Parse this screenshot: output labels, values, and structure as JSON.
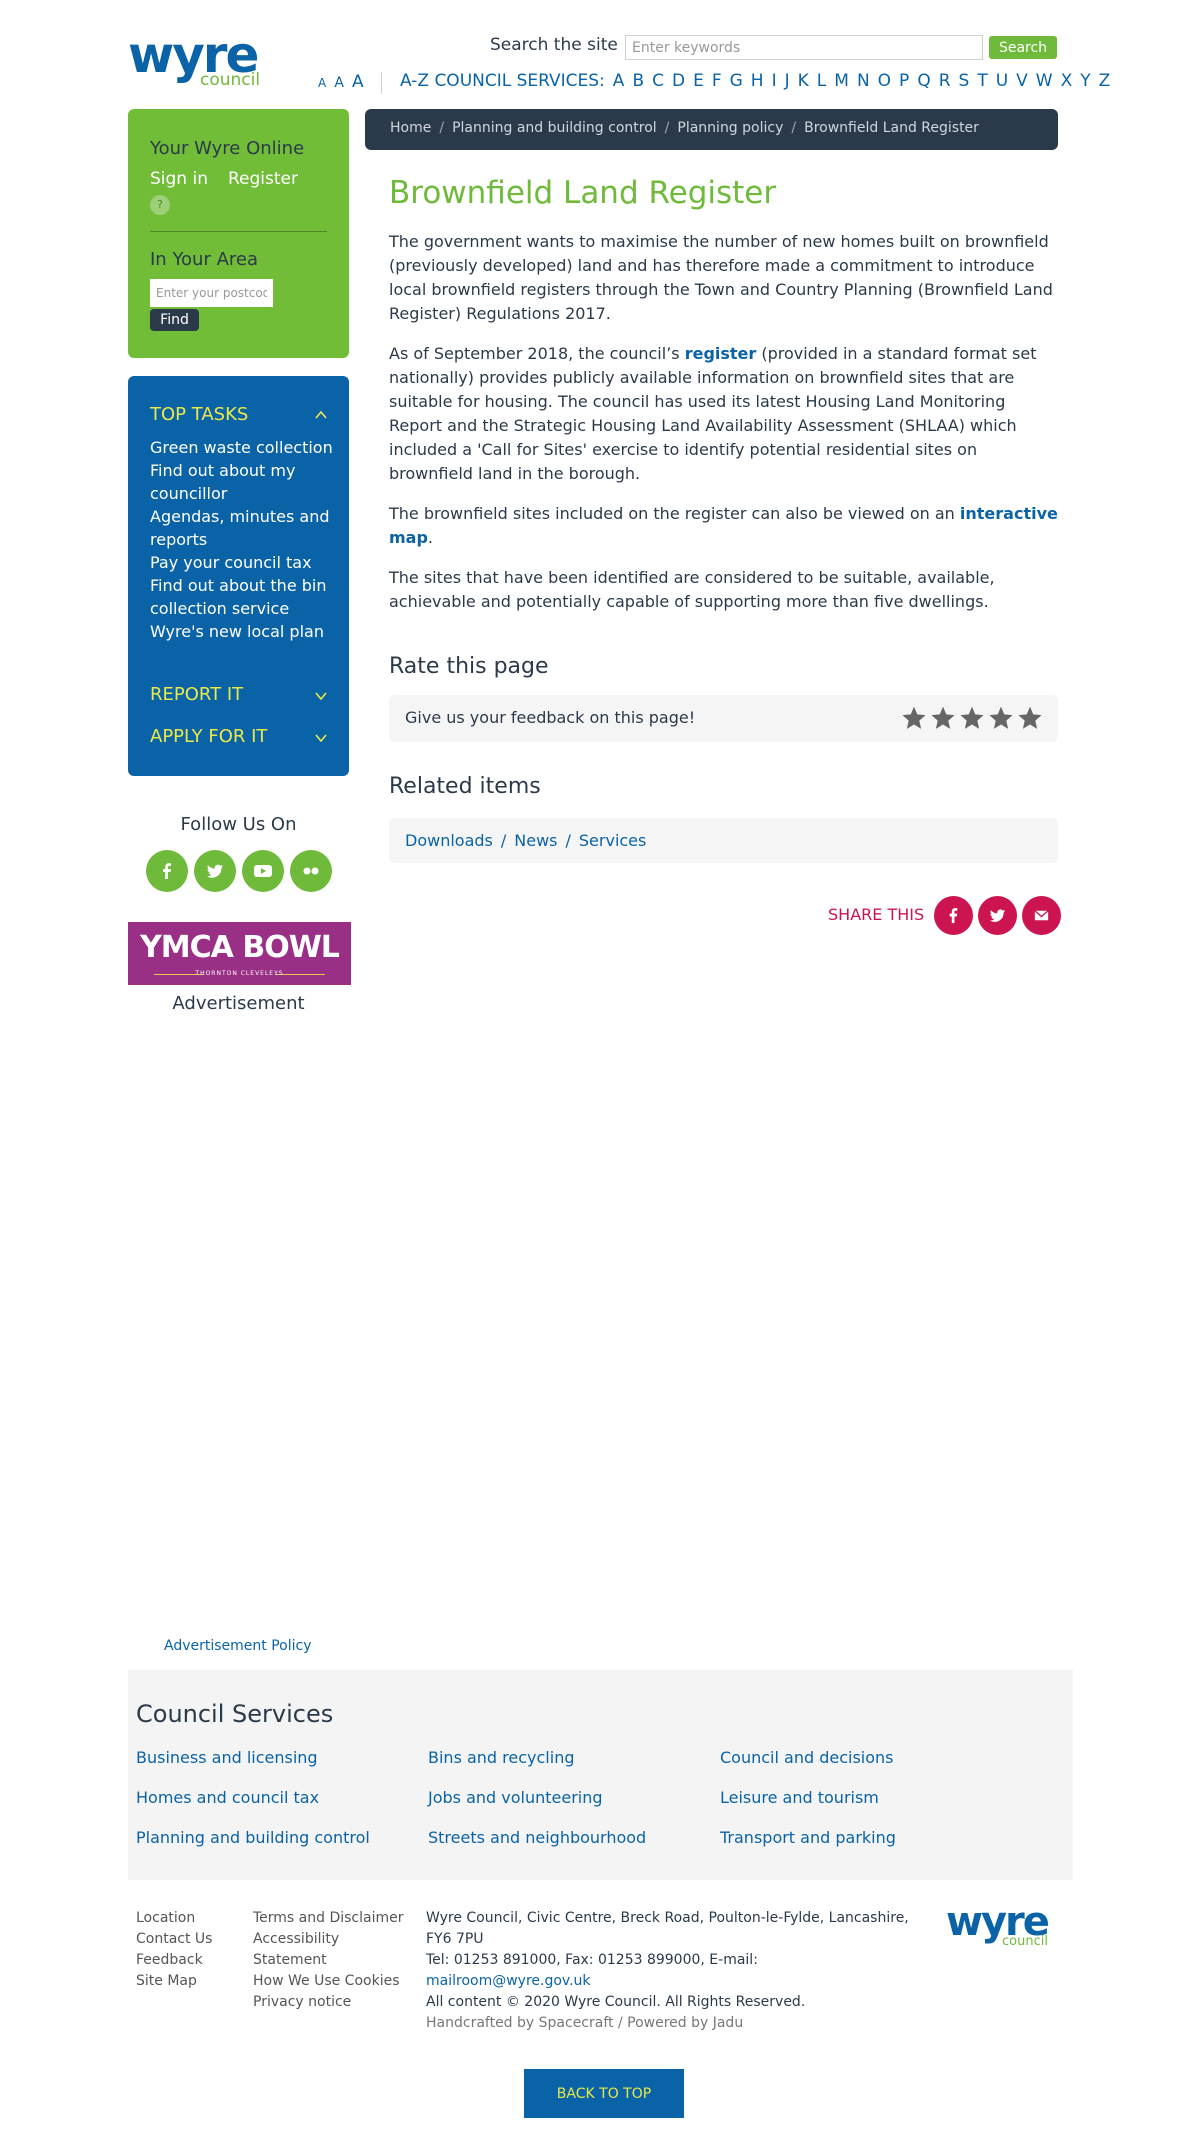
{
  "header": {
    "logo_word": "wyre",
    "logo_sub": "council",
    "search_label": "Search the site",
    "search_placeholder": "Enter keywords",
    "search_button": "Search",
    "text_size": [
      "A",
      "A",
      "A"
    ],
    "az_label": "A-Z COUNCIL SERVICES:",
    "az_letters": [
      "A",
      "B",
      "C",
      "D",
      "E",
      "F",
      "G",
      "H",
      "I",
      "J",
      "K",
      "L",
      "M",
      "N",
      "O",
      "P",
      "Q",
      "R",
      "S",
      "T",
      "U",
      "V",
      "W",
      "X",
      "Y",
      "Z"
    ]
  },
  "sidebar": {
    "online_title": "Your Wyre Online",
    "sign_in": "Sign in",
    "register": "Register",
    "help": "?",
    "area_title": "In Your Area",
    "postcode_placeholder": "Enter your postcode",
    "find_button": "Find",
    "top_tasks": "TOP TASKS",
    "tasks": [
      "Green waste collection",
      "Find out about my councillor",
      "Agendas, minutes and reports",
      "Pay your council tax",
      "Find out about the bin collection service",
      "Wyre's new local plan"
    ],
    "report_it": "REPORT IT",
    "apply_for_it": "APPLY FOR IT",
    "follow_title": "Follow Us On",
    "social_icons": [
      "facebook-icon",
      "twitter-icon",
      "youtube-icon",
      "flickr-icon"
    ],
    "ad_text": "YMCA BOWL",
    "ad_sub": "THORNTON CLEVELEYS",
    "ad_caption": "Advertisement",
    "ad_policy": "Advertisement Policy"
  },
  "breadcrumb": [
    "Home",
    "Planning and building control",
    "Planning policy",
    "Brownfield Land Register"
  ],
  "main": {
    "title": "Brownfield Land Register",
    "p1": "The government wants to maximise the number of new homes built on brownfield (previously developed) land and has therefore made a commitment to introduce local brownfield registers through the Town and Country Planning (Brownfield Land Register) Regulations 2017.",
    "p2_before": "As of September 2018, the council’s ",
    "p2_link": "register",
    "p2_after": " (provided in a standard format set nationally) provides publicly available information on brownfield sites that are suitable for housing. The council has used its latest Housing Land Monitoring Report and the Strategic Housing Land Availability Assessment (SHLAA) which included a 'Call for Sites' exercise to identify potential residential sites on brownfield land in the borough.",
    "p3_before": "The brownfield sites included on the register can also be viewed on an ",
    "p3_link": "interactive map",
    "p3_after": ".",
    "p4": "The sites that have been identified are considered to be suitable, available, achievable and potentially capable of supporting more than five dwellings.",
    "rate_title": "Rate this page",
    "rate_text": "Give us your feedback on this page!",
    "related_title": "Related items",
    "related": [
      "Downloads",
      "News",
      "Services"
    ],
    "share_label": "SHARE THIS"
  },
  "footer": {
    "services_title": "Council Services",
    "services": [
      "Business and licensing",
      "Bins and recycling",
      "Council and decisions",
      "Homes and council tax",
      "Jobs and volunteering",
      "Leisure and tourism",
      "Planning and building control",
      "Streets and neighbourhood",
      "Transport and parking"
    ],
    "links_col1": [
      "Location",
      "Contact Us",
      "Feedback",
      "Site Map"
    ],
    "links_col2": [
      "Terms and Disclaimer",
      "Accessibility",
      "Statement",
      "How We Use Cookies",
      "Privacy notice"
    ],
    "address": "Wyre Council, Civic Centre, Breck Road, Poulton-le-Fylde, Lancashire, FY6 7PU",
    "tel": "Tel: 01253 891000, Fax: 01253 899000, E-mail:",
    "email": "mailroom@wyre.gov.uk",
    "copyright": "All content © 2020 Wyre Council. All Rights Reserved.",
    "credit": "Handcrafted by Spacecraft / Powered by Jadu",
    "back_to_top": "BACK TO TOP"
  },
  "colors": {
    "brand_blue": "#0a63a7",
    "brand_green": "#6fba3a",
    "dark_slate": "#2b3a4a",
    "share_red": "#cc1550",
    "task_yellow": "#e9e948"
  }
}
